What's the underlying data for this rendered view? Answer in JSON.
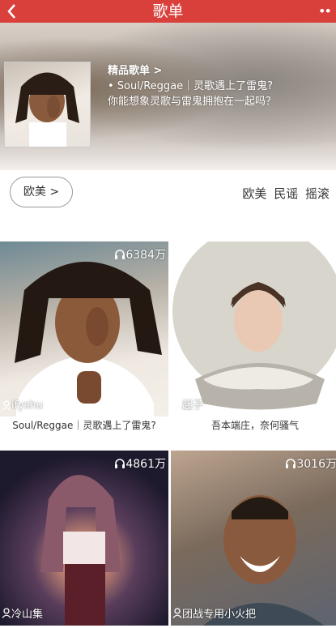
{
  "header": {
    "title": "歌单"
  },
  "hero": {
    "label": "精品歌单 >",
    "line1": "• Soul/Reggae｜灵歌遇上了雷鬼?",
    "line2": "你能想象灵歌与雷鬼拥抱在一起吗？"
  },
  "filter": {
    "category_button": "欧美 >",
    "tags": [
      "欧美",
      "民谣",
      "摇滚"
    ]
  },
  "playlists": [
    {
      "plays": "6384万",
      "author": "ifyshu",
      "title": "Soul/Reggae｜灵歌遇上了雷鬼?"
    },
    {
      "plays": "",
      "author": "起子",
      "title": "吾本端庄，奈何骚气"
    },
    {
      "plays": "4861万",
      "author": "冷山集",
      "title": ""
    },
    {
      "plays": "3016万",
      "author": "团战专用小火把",
      "title": ""
    }
  ],
  "colors": {
    "accent": "#d9403c"
  }
}
